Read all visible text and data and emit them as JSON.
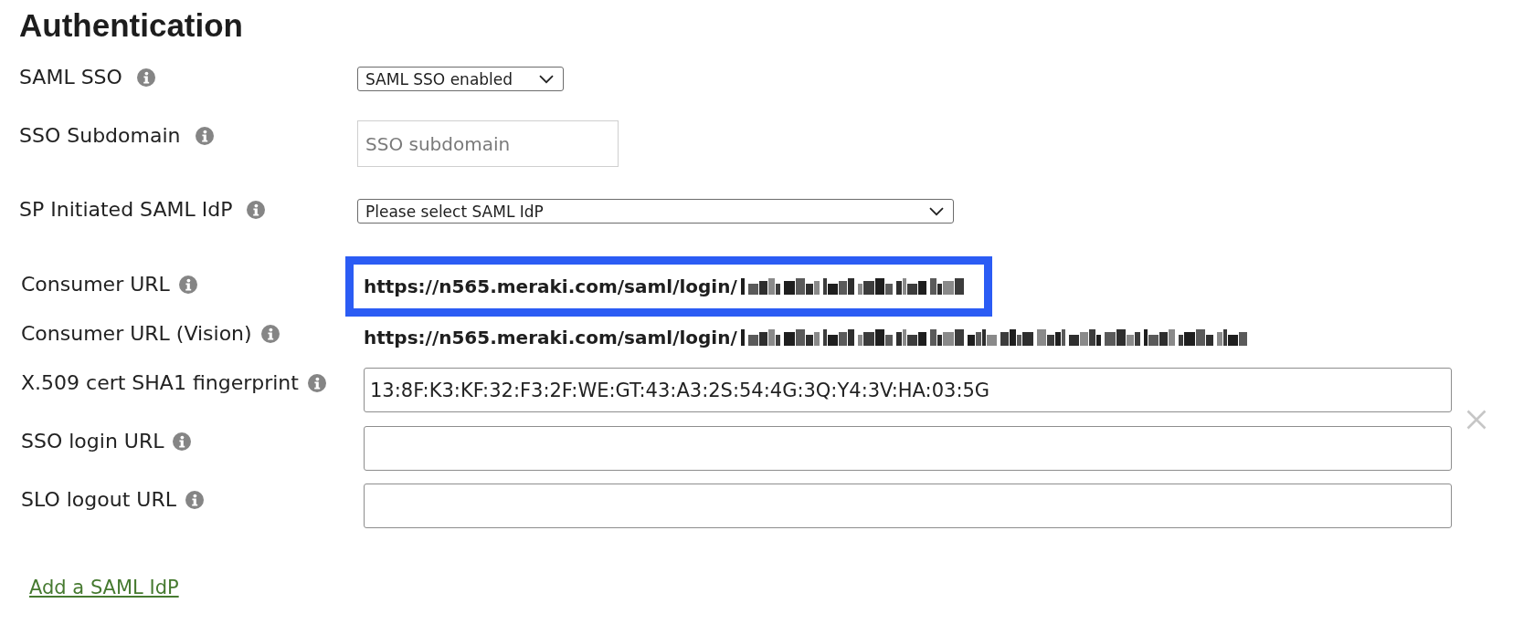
{
  "heading": "Authentication",
  "settings": {
    "fields": [
      {
        "kind": "select",
        "label": "SAML SSO",
        "value": "SAML SSO enabled"
      },
      {
        "kind": "text_input",
        "label": "SSO Subdomain",
        "placeholder": "SSO subdomain"
      },
      {
        "kind": "select",
        "label": "SP Initiated SAML IdP",
        "value": "Please select SAML IdP"
      }
    ]
  },
  "saml_idp": {
    "fields": [
      {
        "kind": "readonly_text",
        "label": "Consumer URL",
        "value": "https://n565.meraki.com/saml/login/",
        "highlighted": true
      },
      {
        "kind": "readonly_text",
        "label": "Consumer URL (Vision)",
        "value": "https://n565.meraki.com/saml/login/",
        "highlighted": false
      },
      {
        "kind": "text_input",
        "label": "X.509 cert SHA1 fingerprint",
        "value": "13:8F:K3:KF:32:F3:2F:WE:GT:43:A3:2S:54:4G:3Q:Y4:3V:HA:03:5G"
      },
      {
        "kind": "text_input",
        "label": "SSO login URL"
      },
      {
        "kind": "text_input",
        "label": "SLO logout URL"
      }
    ]
  },
  "add_link": "Add a SAML IdP"
}
